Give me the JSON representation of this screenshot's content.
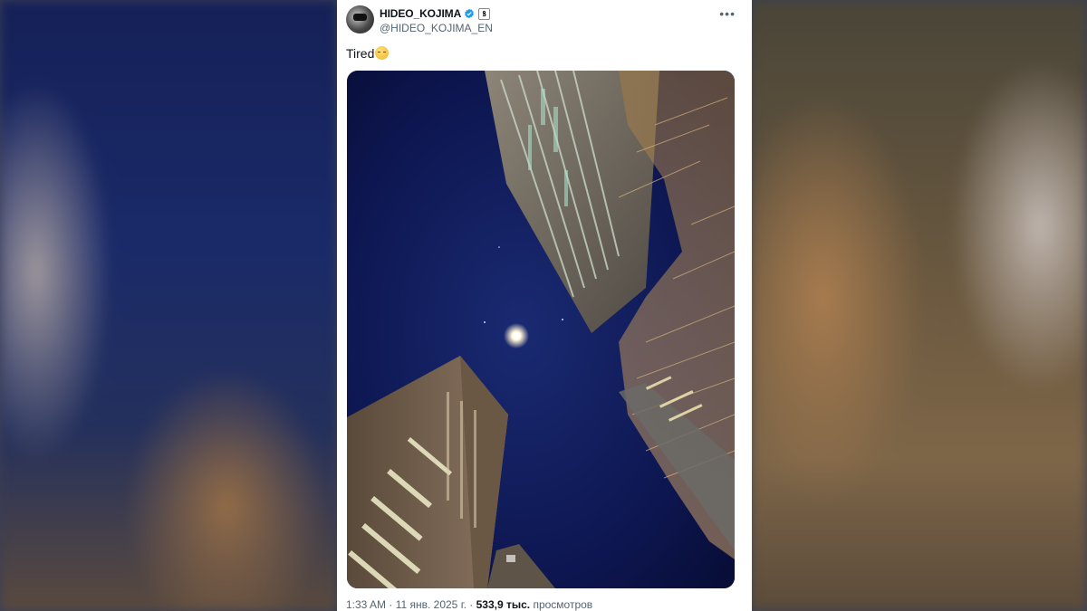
{
  "tweet": {
    "display_name": "HIDEO_KOJIMA",
    "handle": "@HIDEO_KOJIMA_EN",
    "affiliation_badge": "ꝸ",
    "more_label": "•••",
    "text": "Tired",
    "emoji": "sleepy-face-emoji",
    "time": "1:33 AM",
    "separator1": " · ",
    "date": "11 янв. 2025 г.",
    "separator2": " · ",
    "views_count": "533,9 тыс.",
    "views_label": " просмотров"
  },
  "icons": {
    "verified": "verified-badge-icon",
    "affiliation": "affiliation-badge-icon",
    "more": "more-options-icon"
  },
  "colors": {
    "verified_blue": "#1d9bf0",
    "text_primary": "#0f1419",
    "text_secondary": "#536471",
    "sky": "#0b1340"
  }
}
